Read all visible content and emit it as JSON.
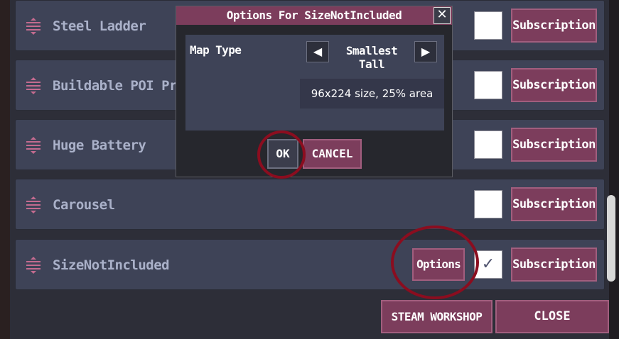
{
  "mods": [
    {
      "name": "Steel Ladder",
      "checked": false,
      "subscription_label": "Subscription"
    },
    {
      "name": "Buildable POI Props",
      "checked": false,
      "subscription_label": "Subscription"
    },
    {
      "name": "Huge Battery",
      "checked": false,
      "subscription_label": "Subscription"
    },
    {
      "name": "Carousel",
      "checked": false,
      "subscription_label": "Subscription"
    },
    {
      "name": "SizeNotIncluded",
      "checked": true,
      "check_glyph": "✓",
      "subscription_label": "Subscription",
      "options_label": "Options"
    }
  ],
  "footer": {
    "steam_workshop_label": "STEAM WORKSHOP",
    "close_label": "CLOSE"
  },
  "dialog": {
    "title": "Options For SizeNotIncluded",
    "close_glyph": "✕",
    "map_type_label": "Map Type",
    "map_type_value": "Smallest Tall",
    "prev_glyph": "◀",
    "next_glyph": "▶",
    "size_info": "96x224 size, 25% area",
    "ok_label": "OK",
    "cancel_label": "CANCEL"
  },
  "icons": {
    "drag_handle": "drag-handle-icon"
  },
  "colors": {
    "accent": "#7c3d5c",
    "row_bg": "#3e4357",
    "highlight_ring": "#8b0d1f"
  }
}
